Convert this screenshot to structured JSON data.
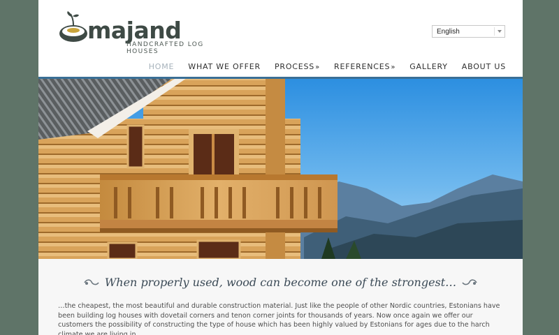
{
  "brand": {
    "name": "majand",
    "tagline": "HANDCRAFTED LOG HOUSES",
    "logo_icon": "sprout-in-pot-logo",
    "accent_color": "#3e4a45"
  },
  "language": {
    "selected": "English"
  },
  "nav": {
    "items": [
      {
        "label": "HOME",
        "active": true,
        "has_submenu": false
      },
      {
        "label": "WHAT WE OFFER",
        "active": false,
        "has_submenu": false
      },
      {
        "label": "PROCESS",
        "active": false,
        "has_submenu": true
      },
      {
        "label": "REFERENCES",
        "active": false,
        "has_submenu": true
      },
      {
        "label": "GALLERY",
        "active": false,
        "has_submenu": false
      },
      {
        "label": "ABOUT US",
        "active": false,
        "has_submenu": false
      }
    ],
    "submenu_marker": "»"
  },
  "hero": {
    "image": "wooden-log-house-with-balcony-and-mountains"
  },
  "content": {
    "headline": "When properly used, wood can become one of the strongest…",
    "body": "…the cheapest, the most beautiful and durable construction material. Just like the people of other Nordic countries, Estonians have been building log houses with dovetail corners and tenon corner joints for thousands of years. Now once again we offer our customers the possibility of constructing the type of house which has been highly valued by Estonians for ages due to the harch climate we are living in."
  },
  "colors": {
    "background": "#5f7468",
    "nav_active": "#a6b2bb",
    "headline": "#3b4a56"
  }
}
